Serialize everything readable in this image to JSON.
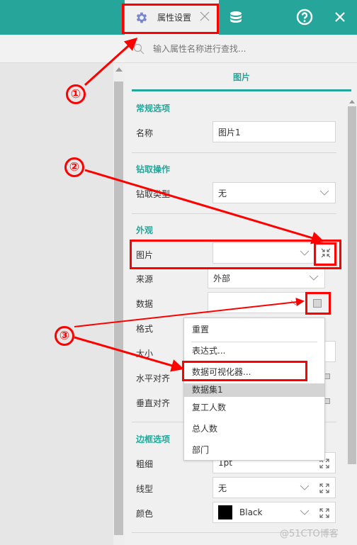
{
  "topbar": {
    "active_tab_label": "属性设置",
    "icons": [
      "gear-icon",
      "close-icon",
      "database-icon",
      "help-icon",
      "close-window-icon"
    ],
    "accent_color": "#26a69a"
  },
  "panel": {
    "search_placeholder": "输入属性名称进行查找...",
    "tab_label": "图片",
    "sections": {
      "general": {
        "title": "常规选项",
        "name_label": "名称",
        "name_value": "图片1"
      },
      "drill": {
        "title": "钻取操作",
        "type_label": "钻取类型",
        "type_value": "无"
      },
      "appearance": {
        "title": "外观",
        "image_label": "图片",
        "image_value": "",
        "source_label": "来源",
        "source_value": "外部",
        "data_label": "数据",
        "data_value": "",
        "format_label": "格式",
        "size_label": "大小",
        "halign_label": "水平对齐",
        "valign_label": "垂直对齐"
      },
      "border": {
        "title": "边框选项",
        "weight_label": "粗细",
        "weight_value": "1pt",
        "style_label": "线型",
        "style_value": "无",
        "color_label": "颜色",
        "color_value": "Black",
        "color_swatch": "#000000"
      }
    }
  },
  "menu": {
    "items": [
      "重置",
      "表达式...",
      "数据可视化器..."
    ],
    "group_header": "数据集1",
    "fields": [
      "复工人数",
      "总人数",
      "部门"
    ]
  },
  "annotations": {
    "markers": [
      "①",
      "②",
      "③"
    ],
    "color": "#ff0000"
  },
  "watermark": "@51CTO博客"
}
